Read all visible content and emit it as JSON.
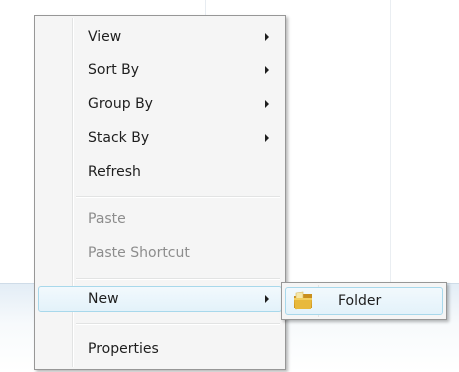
{
  "context_menu": {
    "items": [
      {
        "label": "View",
        "submenu": true,
        "disabled": false
      },
      {
        "label": "Sort By",
        "submenu": true,
        "disabled": false
      },
      {
        "label": "Group By",
        "submenu": true,
        "disabled": false
      },
      {
        "label": "Stack By",
        "submenu": true,
        "disabled": false
      },
      {
        "label": "Refresh",
        "submenu": false,
        "disabled": false
      },
      {
        "label": "Paste",
        "submenu": false,
        "disabled": true
      },
      {
        "label": "Paste Shortcut",
        "submenu": false,
        "disabled": true
      },
      {
        "label": "New",
        "submenu": true,
        "disabled": false,
        "highlighted": true
      },
      {
        "label": "Properties",
        "submenu": false,
        "disabled": false
      }
    ]
  },
  "new_submenu": {
    "items": [
      {
        "label": "Folder",
        "icon": "folder-icon",
        "highlighted": true
      }
    ]
  },
  "colors": {
    "highlight_border": "#a8d8eb",
    "highlight_fill": "#e3f2fa",
    "folder": "#e8b93c"
  }
}
